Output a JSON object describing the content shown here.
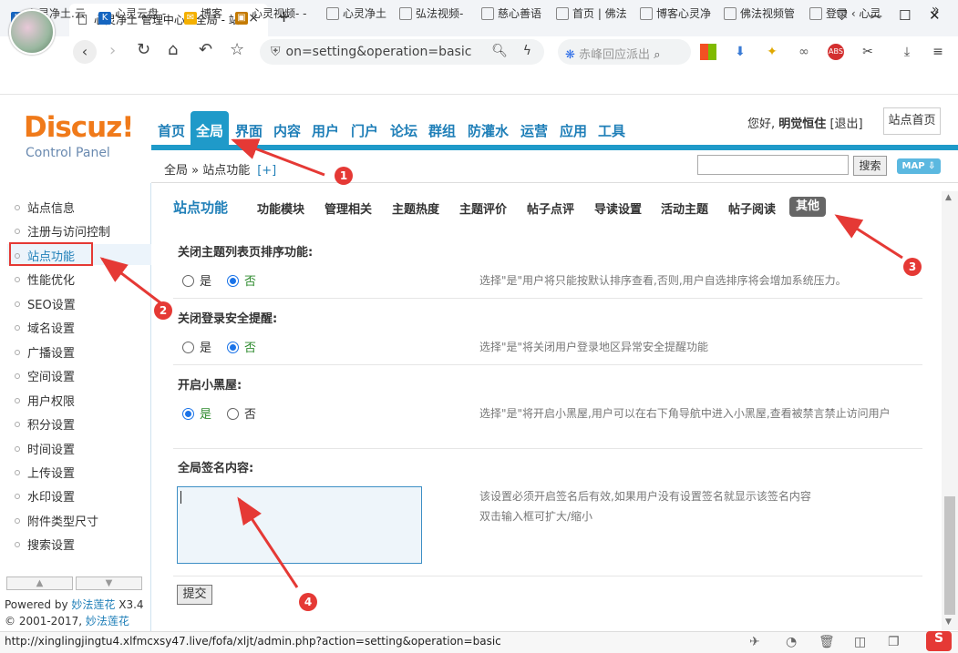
{
  "browser": {
    "tab_title": "心灵净土 管理中心 - 全局 - 站",
    "tab_close": "×",
    "new_tab": "+",
    "url": "on=setting&operation=basic",
    "search_placeholder": "赤峰回应派出",
    "url_status": "http://xinglingjingtu4.xlfmcxsy47.live/fofa/xljt/admin.php?action=setting&operation=basic",
    "bookmarks": [
      "心灵净土.云",
      "心灵云盘 -",
      "博客",
      "心灵视频- -",
      "心灵净土",
      "弘法视频-",
      "慈心善语",
      "首页 | 佛法",
      "博客心灵净",
      "佛法视频管",
      "登录 ‹ 心灵"
    ],
    "more_bookmarks": "»"
  },
  "admin": {
    "logo": "Discuz!",
    "logo_sub": "Control Panel",
    "nav": [
      "首页",
      "全局",
      "界面",
      "内容",
      "用户",
      "门户",
      "论坛",
      "群组",
      "防灌水",
      "运营",
      "应用",
      "工具"
    ],
    "nav_active": "全局",
    "greeting": "您好,",
    "username": "明觉恒住",
    "logout": "[退出]",
    "site_home": "站点首页",
    "breadcrumb": "全局 » 站点功能",
    "breadcrumb_plus": "[+]",
    "search_button": "搜索",
    "map_button": "MAP ⇩"
  },
  "sidebar": {
    "items": [
      "站点信息",
      "注册与访问控制",
      "站点功能",
      "性能优化",
      "SEO设置",
      "域名设置",
      "广播设置",
      "空间设置",
      "用户权限",
      "积分设置",
      "时间设置",
      "上传设置",
      "水印设置",
      "附件类型尺寸",
      "搜索设置"
    ],
    "active": "站点功能",
    "scroll_up": "▲",
    "scroll_down": "▼",
    "powered_prefix": "Powered by",
    "powered_link": "妙法莲花",
    "version": "X3.4",
    "copyright_prefix": "© 2001-2017,",
    "copyright_link": "妙法莲花"
  },
  "content": {
    "title": "站点功能",
    "tabs": [
      "功能模块",
      "管理相关",
      "主题热度",
      "主题评价",
      "帖子点评",
      "导读设置",
      "活动主题",
      "帖子阅读"
    ],
    "active_tab": "其他",
    "settings": [
      {
        "label": "关闭主题列表页排序功能:",
        "yes": "是",
        "no": "否",
        "selected": "否",
        "hint": "选择\"是\"用户将只能按默认排序查看,否则,用户自选排序将会增加系统压力。"
      },
      {
        "label": "关闭登录安全提醒:",
        "yes": "是",
        "no": "否",
        "selected": "否",
        "hint": "选择\"是\"将关闭用户登录地区异常安全提醒功能"
      },
      {
        "label": "开启小黑屋:",
        "yes": "是",
        "no": "否",
        "selected": "是",
        "hint": "选择\"是\"将开启小黑屋,用户可以在右下角导航中进入小黑屋,查看被禁言禁止访问用户"
      }
    ],
    "signature_label": "全局签名内容:",
    "signature_value": "",
    "signature_hint1": "该设置必须开启签名后有效,如果用户没有设置签名就显示该签名内容",
    "signature_hint2": "双击输入框可扩大/缩小",
    "submit": "提交"
  },
  "annotations": [
    "1",
    "2",
    "3",
    "4"
  ],
  "colors": {
    "accent": "#1f9ac9",
    "logo": "#f07a1a",
    "annotation": "#e53935"
  }
}
